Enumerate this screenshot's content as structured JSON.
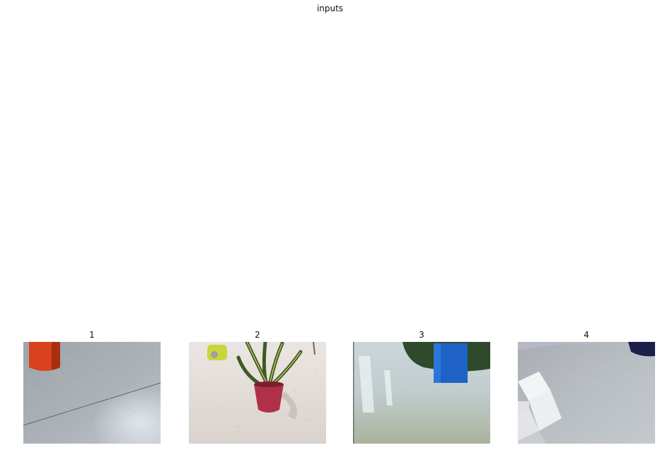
{
  "figure": {
    "title": "inputs"
  },
  "panels": [
    {
      "label": "1",
      "image_description_icon": "red-cylinder-on-gray-floor-photo"
    },
    {
      "label": "2",
      "image_description_icon": "potted-plant-on-tiled-floor-photo"
    },
    {
      "label": "3",
      "image_description_icon": "blue-box-on-shiny-floor-photo"
    },
    {
      "label": "4",
      "image_description_icon": "white-boxes-on-floor-photo"
    }
  ]
}
